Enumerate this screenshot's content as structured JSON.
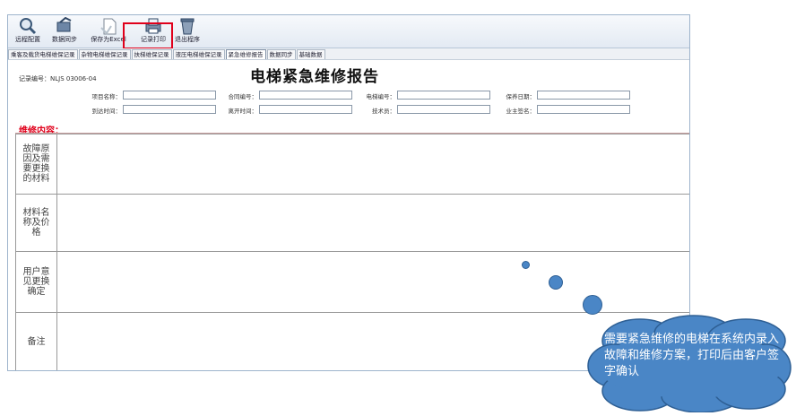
{
  "toolbar": {
    "items": [
      {
        "label": "远程配置",
        "icon": "magnifier-tool-icon"
      },
      {
        "label": "数据同步",
        "icon": "sync-icon"
      },
      {
        "label": "保存为Excel",
        "icon": "document-save-icon"
      },
      {
        "label": "记录打印",
        "icon": "printer-icon"
      },
      {
        "label": "退出程序",
        "icon": "exit-icon"
      }
    ]
  },
  "tabs": [
    "乘客及载货电梯维保记录",
    "杂物电梯维保记录",
    "扶梯维保记录",
    "液压电梯维保记录",
    "紧急维修报告",
    "数据同步",
    "基础数据"
  ],
  "active_tab": "紧急维修报告",
  "record_no": "记录编号：NLJS 03006-04",
  "report_title": "电梯紧急维修报告",
  "form": {
    "project_name": "项目名称：",
    "contract_no": "合同编号：",
    "elevator_no": "电梯编号：",
    "service_date": "保养日期：",
    "arrival_time": "到达时间：",
    "leave_time": "离开时间：",
    "technician": "技术员：",
    "owner_sign": "业主签名："
  },
  "section_heading": "维修内容：",
  "grid_labels": [
    "故障原因及需要更换的材料",
    "材料名称及价格",
    "用户意见更换确定",
    "备注"
  ],
  "callout": "需要紧急维修的电梯在系统内录入故障和维修方案，打印后由客户签字确认",
  "colors": {
    "highlight": "#e0001b",
    "callout": "#4a86c6",
    "section": "#e0001b"
  }
}
